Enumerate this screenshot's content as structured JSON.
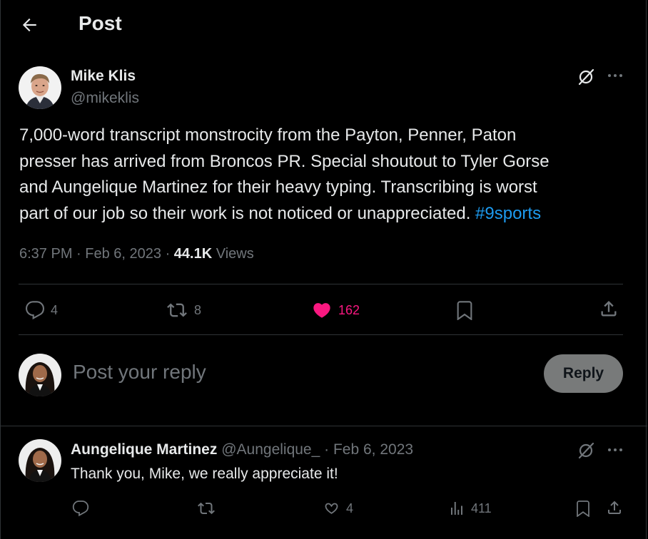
{
  "header": {
    "title": "Post"
  },
  "post": {
    "author_name": "Mike Klis",
    "author_handle": "@mikeklis",
    "text": "7,000-word transcript monstrocity from the Payton, Penner, Paton\npresser has arrived from Broncos PR. Special shoutout to Tyler Gorse\nand Aungelique Martinez for their heavy typing. Transcribing is worst\npart of our job so their work is not noticed or unappreciated. ",
    "hashtag": "#9sports",
    "time": "6:37 PM",
    "date": "Feb 6, 2023",
    "views_count": "44.1K",
    "views_label": "Views",
    "replies": "4",
    "reposts": "8",
    "likes": "162"
  },
  "composer": {
    "placeholder": "Post your reply",
    "button_label": "Reply"
  },
  "reply": {
    "author_name": "Aungelique Martinez",
    "author_handle": "@Aungelique_",
    "separator": "·",
    "date": "Feb 6, 2023",
    "text": "Thank you, Mike, we really appreciate it!",
    "likes": "4",
    "views": "411"
  },
  "colors": {
    "background": "#000000",
    "text": "#e7e9ea",
    "muted": "#71767b",
    "link": "#1d9bf0",
    "like": "#f91880",
    "divider": "#2f3336"
  },
  "icons": [
    "back-arrow-icon",
    "grok-icon",
    "more-icon",
    "reply-icon",
    "repost-icon",
    "heart-icon",
    "bookmark-icon",
    "share-icon",
    "views-icon"
  ]
}
